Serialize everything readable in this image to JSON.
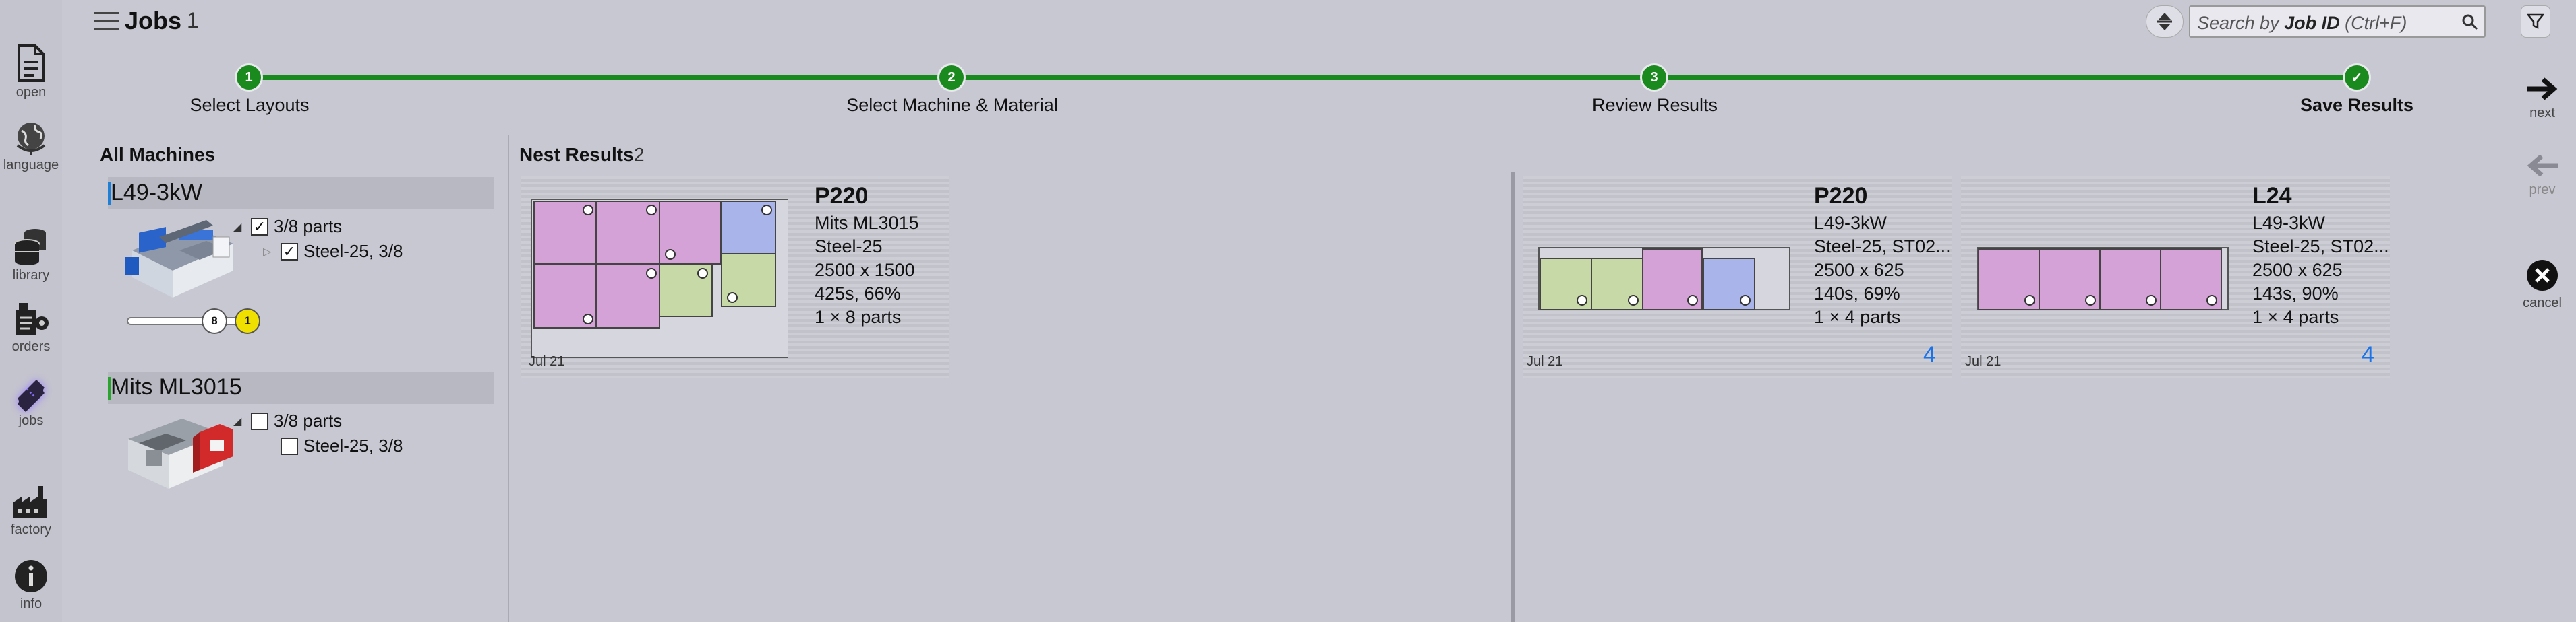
{
  "nav": {
    "open": "open",
    "language": "language",
    "library": "library",
    "orders": "orders",
    "jobs": "jobs",
    "factory": "factory",
    "info": "info"
  },
  "header": {
    "title": "Jobs",
    "count": "1"
  },
  "search": {
    "prefix": "Search by ",
    "field": "Job ID",
    "shortcut": " (Ctrl+F)"
  },
  "stepper": {
    "steps": [
      {
        "number": "1",
        "label": "Select Layouts"
      },
      {
        "number": "2",
        "label": "Select Machine & Material"
      },
      {
        "number": "3",
        "label": "Review Results"
      },
      {
        "number": "✓",
        "label": "Save Results"
      }
    ]
  },
  "right_nav": {
    "next": "next",
    "prev": "prev",
    "cancel": "cancel"
  },
  "machines": {
    "title": "All Machines",
    "items": [
      {
        "name": "L49-3kW",
        "accent": "#1d7fd6",
        "parts_label": "3/8 parts",
        "parts_checked": "✓",
        "material_label": "Steel-25, 3/8",
        "material_checked": "✓",
        "slider_value": "8",
        "slider_badge": "1"
      },
      {
        "name": "Mits ML3015",
        "accent": "#29a52e",
        "parts_label": "3/8 parts",
        "parts_checked": "",
        "material_label": "Steel-25, 3/8",
        "material_checked": ""
      }
    ]
  },
  "results": {
    "title": "Nest Results",
    "count": "2",
    "cards": [
      {
        "title": "P220",
        "machine": "Mits ML3015",
        "material": "Steel-25",
        "sheet": "2500 x 1500",
        "time": "425s, 66%",
        "parts": "1 × 8 parts",
        "date": "Jul 21",
        "qty": ""
      },
      {
        "title": "P220",
        "machine": "L49-3kW",
        "material": "Steel-25, ST02...",
        "sheet": "2500 x 625",
        "time": "140s, 69%",
        "parts": "1 × 4 parts",
        "date": "Jul 21",
        "qty": "4"
      },
      {
        "title": "L24",
        "machine": "L49-3kW",
        "material": "Steel-25, ST02...",
        "sheet": "2500 x 625",
        "time": "143s, 90%",
        "parts": "1 × 4 parts",
        "date": "Jul 21",
        "qty": "4"
      }
    ]
  },
  "colors": {
    "stepper": "#198a1e",
    "part_pink": "#d4a2d6",
    "part_green": "#c6d9a6",
    "part_blue": "#a9b5ea",
    "qty_blue": "#1a73e8"
  }
}
